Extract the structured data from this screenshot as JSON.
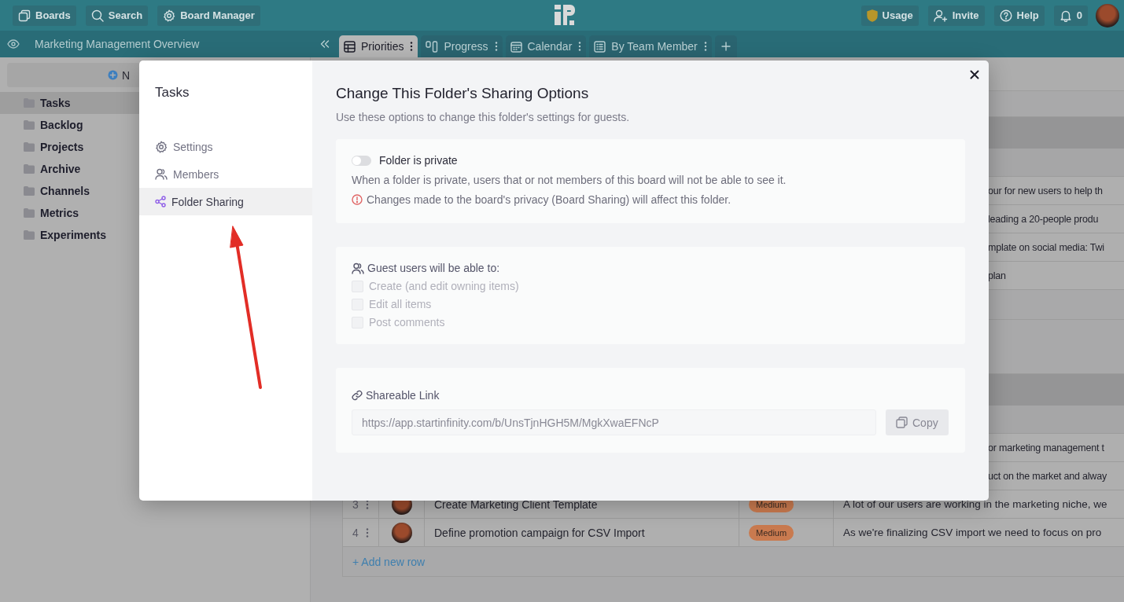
{
  "top_bar": {
    "left_buttons": [
      {
        "label": "Boards",
        "kind": "boards"
      },
      {
        "label": "Search",
        "kind": "search"
      },
      {
        "label": "Board Manager",
        "kind": "settings"
      }
    ],
    "right_buttons": [
      {
        "label": "Usage",
        "kind": "usage"
      },
      {
        "label": "Invite",
        "kind": "invite"
      },
      {
        "label": "Help",
        "kind": "help"
      },
      {
        "label": "0",
        "kind": "notifications"
      }
    ]
  },
  "board_bar": {
    "title": "Marketing Management Overview",
    "tabs": [
      {
        "label": "Priorities",
        "kind": "table",
        "selected": true
      },
      {
        "label": "Progress",
        "kind": "columns",
        "selected": false
      },
      {
        "label": "Calendar",
        "kind": "calendar",
        "selected": false
      },
      {
        "label": "By Team Member",
        "kind": "list",
        "selected": false
      }
    ]
  },
  "sidebar": {
    "new_button": "N",
    "folders": [
      {
        "label": "Tasks",
        "selected": true
      },
      {
        "label": "Backlog",
        "selected": false
      },
      {
        "label": "Projects",
        "selected": false
      },
      {
        "label": "Archive",
        "selected": false
      },
      {
        "label": "Channels",
        "selected": false
      },
      {
        "label": "Metrics",
        "selected": false
      },
      {
        "label": "Experiments",
        "selected": false
      }
    ]
  },
  "table": {
    "groups": [
      {
        "rows": [
          {
            "description": "our for new users to help th"
          },
          {
            "description": "leading a 20-people produ"
          },
          {
            "description": "mplate on social media: Twi"
          },
          {
            "description": "plan"
          }
        ]
      },
      {
        "rows": [
          {
            "description": "or marketing management t"
          },
          {
            "description": "uct on the market and alway"
          },
          {
            "number": "3",
            "title": "Create Marketing Client Template",
            "priority": "Medium",
            "description": "A lot of our users are working in the marketing niche, we"
          },
          {
            "number": "4",
            "title": "Define promotion campaign for CSV Import",
            "priority": "Medium",
            "description": "As we're finalizing CSV import we need to focus on pro"
          }
        ],
        "add_row": "+ Add new row"
      }
    ]
  },
  "dialog": {
    "title": "Tasks",
    "menu": [
      {
        "label": "Settings",
        "kind": "settings",
        "selected": false
      },
      {
        "label": "Members",
        "kind": "members",
        "selected": false
      },
      {
        "label": "Folder Sharing",
        "kind": "share",
        "selected": true
      }
    ],
    "heading": "Change This Folder's Sharing Options",
    "subheading": "Use these options to change this folder's settings for guests.",
    "privacy": {
      "toggle_label": "Folder is private",
      "on": false,
      "note": "When a folder is private, users that or not members of this board will not be able to see it.",
      "warning": "Changes made to the board's privacy (Board Sharing) will affect this folder."
    },
    "guests": {
      "heading": "Guest users will be able to:",
      "options": [
        {
          "label": "Create (and edit owning items)",
          "checked": false,
          "disabled": true
        },
        {
          "label": "Edit all items",
          "checked": false,
          "disabled": true
        },
        {
          "label": "Post comments",
          "checked": false,
          "disabled": true
        }
      ]
    },
    "link": {
      "label": "Shareable Link",
      "value": "https://app.startinfinity.com/b/UnsTjnHGH5M/MgkXwaEFNcP",
      "copy": "Copy"
    }
  }
}
